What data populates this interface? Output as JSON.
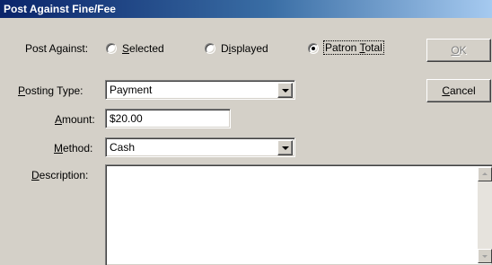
{
  "window": {
    "title": "Post Against Fine/Fee"
  },
  "post_against": {
    "label": "Post Against:",
    "options": [
      {
        "pre": "",
        "key": "S",
        "post": "elected",
        "selected": false
      },
      {
        "pre": "D",
        "key": "i",
        "post": "splayed",
        "selected": false
      },
      {
        "pre": "Patron ",
        "key": "T",
        "post": "otal",
        "selected": true
      }
    ]
  },
  "posting_type": {
    "label_key": "P",
    "label_rest": "osting Type:",
    "value": "Payment"
  },
  "amount": {
    "label_key": "A",
    "label_rest": "mount:",
    "value": "$20.00"
  },
  "method": {
    "label_key": "M",
    "label_rest": "ethod:",
    "value": "Cash"
  },
  "description": {
    "label_key": "D",
    "label_rest": "escription:",
    "value": ""
  },
  "buttons": {
    "ok": {
      "key": "O",
      "rest": "K",
      "enabled": false
    },
    "cancel": {
      "key": "C",
      "rest": "ancel",
      "enabled": true
    }
  },
  "icons": [
    "dropdown-arrow-icon",
    "scroll-up-icon",
    "scroll-down-icon"
  ]
}
